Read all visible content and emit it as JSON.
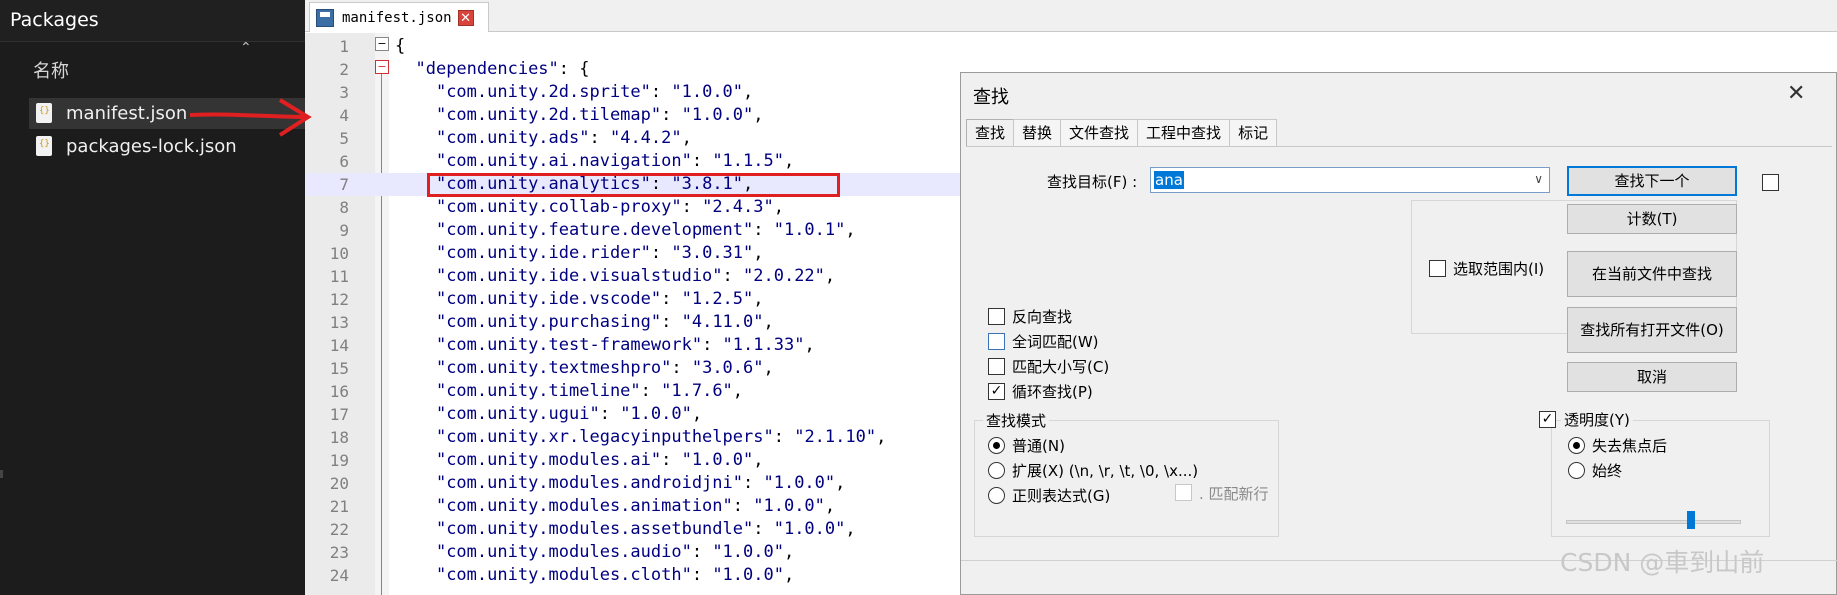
{
  "explorer": {
    "title": "Packages",
    "column_header": "名称",
    "files": [
      {
        "name": "manifest.json",
        "selected": true
      },
      {
        "name": "packages-lock.json",
        "selected": false
      }
    ]
  },
  "editor": {
    "tab_label": "manifest.json",
    "current_line": 7,
    "lines": [
      {
        "n": "1",
        "text": "{"
      },
      {
        "n": "2",
        "text": "  \"dependencies\": {"
      },
      {
        "n": "3",
        "text": "    \"com.unity.2d.sprite\": \"1.0.0\","
      },
      {
        "n": "4",
        "text": "    \"com.unity.2d.tilemap\": \"1.0.0\","
      },
      {
        "n": "5",
        "text": "    \"com.unity.ads\": \"4.4.2\","
      },
      {
        "n": "6",
        "text": "    \"com.unity.ai.navigation\": \"1.1.5\","
      },
      {
        "n": "7",
        "text": "    \"com.unity.analytics\": \"3.8.1\","
      },
      {
        "n": "8",
        "text": "    \"com.unity.collab-proxy\": \"2.4.3\","
      },
      {
        "n": "9",
        "text": "    \"com.unity.feature.development\": \"1.0.1\","
      },
      {
        "n": "10",
        "text": "    \"com.unity.ide.rider\": \"3.0.31\","
      },
      {
        "n": "11",
        "text": "    \"com.unity.ide.visualstudio\": \"2.0.22\","
      },
      {
        "n": "12",
        "text": "    \"com.unity.ide.vscode\": \"1.2.5\","
      },
      {
        "n": "13",
        "text": "    \"com.unity.purchasing\": \"4.11.0\","
      },
      {
        "n": "14",
        "text": "    \"com.unity.test-framework\": \"1.1.33\","
      },
      {
        "n": "15",
        "text": "    \"com.unity.textmeshpro\": \"3.0.6\","
      },
      {
        "n": "16",
        "text": "    \"com.unity.timeline\": \"1.7.6\","
      },
      {
        "n": "17",
        "text": "    \"com.unity.ugui\": \"1.0.0\","
      },
      {
        "n": "18",
        "text": "    \"com.unity.xr.legacyinputhelpers\": \"2.1.10\","
      },
      {
        "n": "19",
        "text": "    \"com.unity.modules.ai\": \"1.0.0\","
      },
      {
        "n": "20",
        "text": "    \"com.unity.modules.androidjni\": \"1.0.0\","
      },
      {
        "n": "21",
        "text": "    \"com.unity.modules.animation\": \"1.0.0\","
      },
      {
        "n": "22",
        "text": "    \"com.unity.modules.assetbundle\": \"1.0.0\","
      },
      {
        "n": "23",
        "text": "    \"com.unity.modules.audio\": \"1.0.0\","
      },
      {
        "n": "24",
        "text": "    \"com.unity.modules.cloth\": \"1.0.0\","
      }
    ]
  },
  "find_dialog": {
    "title": "查找",
    "tabs": [
      "查找",
      "替换",
      "文件查找",
      "工程中查找",
      "标记"
    ],
    "active_tab": "查找",
    "find_target_label": "查找目标(F) :",
    "find_target_value": "ana",
    "buttons": {
      "find_next": "查找下一个",
      "count": "计数(T)",
      "find_in_current": "在当前文件中查找",
      "find_all_open": "查找所有打开文件(O)",
      "cancel": "取消"
    },
    "in_selection": {
      "label": "选取范围内(I)",
      "checked": false
    },
    "options": [
      {
        "label": "反向查找",
        "checked": false
      },
      {
        "label": "全词匹配(W)",
        "checked": false
      },
      {
        "label": "匹配大小写(C)",
        "checked": false
      },
      {
        "label": "循环查找(P)",
        "checked": true
      }
    ],
    "search_mode": {
      "label": "查找模式",
      "options": [
        "普通(N)",
        "扩展(X) (\\n, \\r, \\t, \\0, \\x...)",
        "正则表达式(G)"
      ],
      "selected": "普通(N)",
      "match_newline": ". 匹配新行"
    },
    "transparency": {
      "label": "透明度(Y)",
      "checked": true,
      "options": [
        "失去焦点后",
        "始终"
      ],
      "selected": "失去焦点后",
      "level": 0.75
    }
  },
  "watermark": "CSDN @車到山前",
  "colors": {
    "annotation_red": "#e02020",
    "selection_blue": "#0078d7"
  }
}
